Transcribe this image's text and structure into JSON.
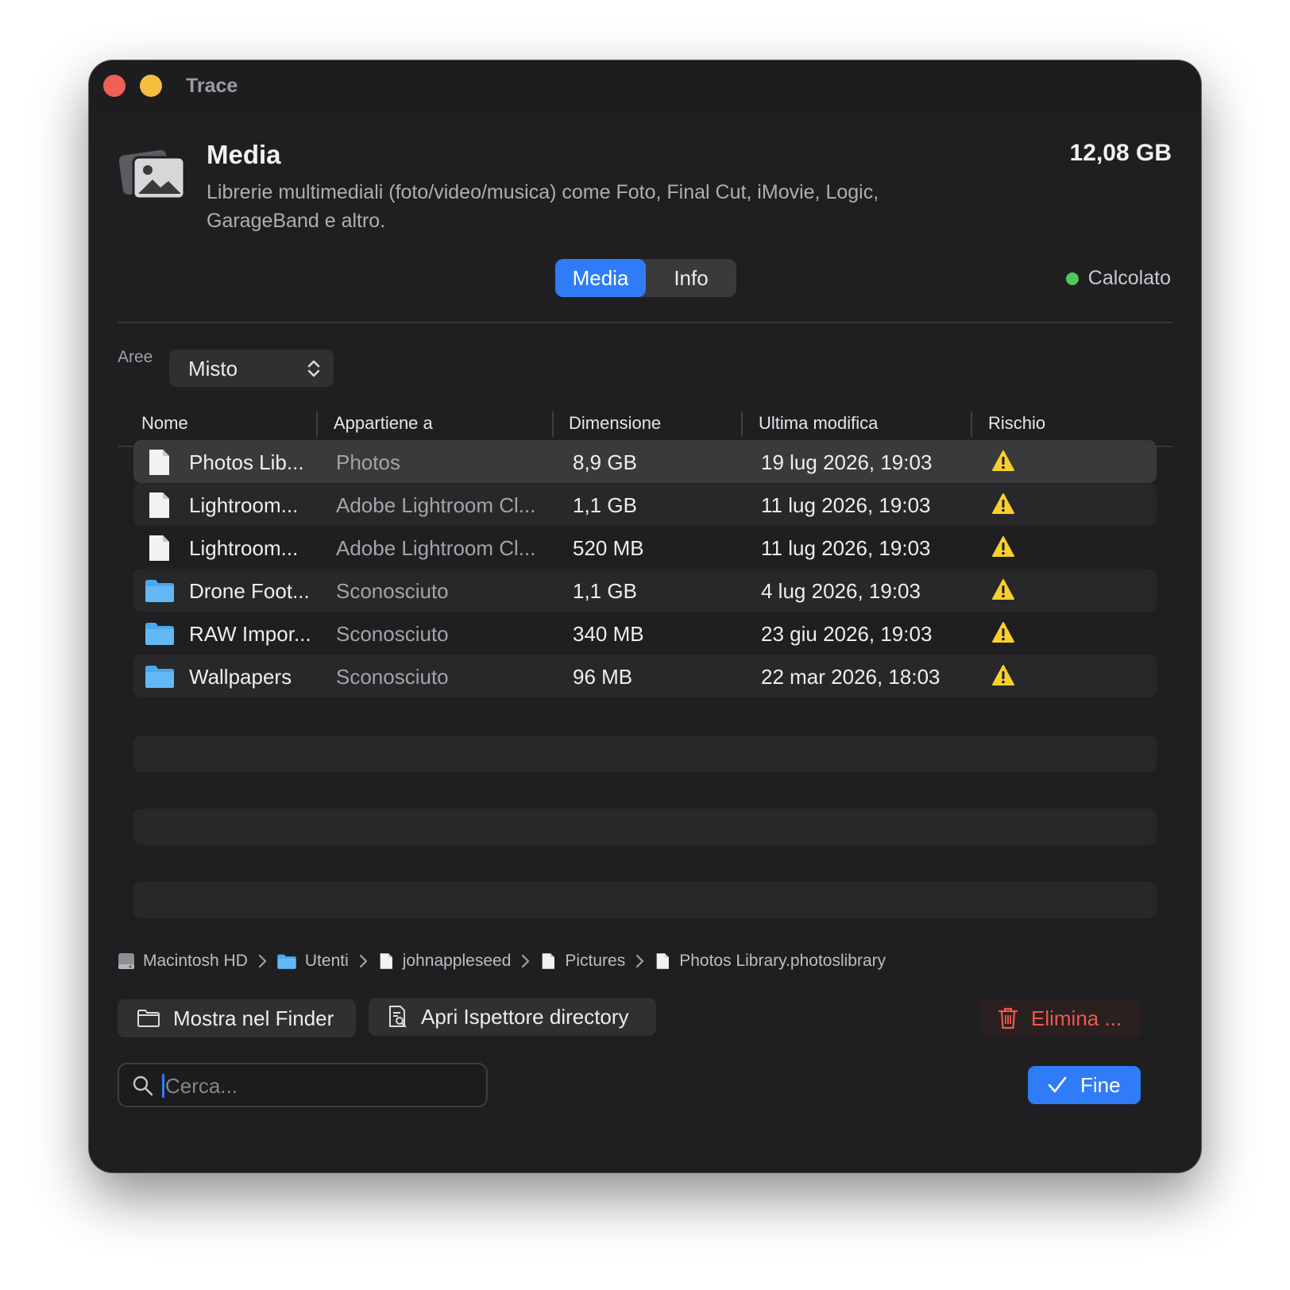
{
  "window": {
    "title": "Trace"
  },
  "header": {
    "title": "Media",
    "description": "Librerie multimediali (foto/video/musica) come Foto, Final Cut, iMovie, Logic, GarageBand e altro.",
    "total_size": "12,08 GB",
    "icon": "photo-library-icon"
  },
  "tabs": [
    {
      "label": "Media",
      "active": true
    },
    {
      "label": "Info",
      "active": false
    }
  ],
  "status": {
    "label": "Calcolato",
    "color": "#4fc85a"
  },
  "filter": {
    "label": "Aree",
    "value": "Misto"
  },
  "table": {
    "columns": [
      "Nome",
      "Appartiene a",
      "Dimensione",
      "Ultima modifica",
      "Rischio"
    ],
    "rows": [
      {
        "name": "Photos Lib...",
        "owner": "Photos",
        "size": "8,9 GB",
        "modified": "19 lug 2026, 19:03",
        "kind": "file",
        "risk": "warning"
      },
      {
        "name": "Lightroom...",
        "owner": "Adobe Lightroom Cl...",
        "size": "1,1 GB",
        "modified": "11 lug 2026, 19:03",
        "kind": "file",
        "risk": "warning"
      },
      {
        "name": "Lightroom...",
        "owner": "Adobe Lightroom Cl...",
        "size": "520 MB",
        "modified": "11 lug 2026, 19:03",
        "kind": "file",
        "risk": "warning"
      },
      {
        "name": "Drone Foot...",
        "owner": "Sconosciuto",
        "size": "1,1 GB",
        "modified": "4 lug 2026, 19:03",
        "kind": "folder",
        "risk": "warning"
      },
      {
        "name": "RAW Impor...",
        "owner": "Sconosciuto",
        "size": "340 MB",
        "modified": "23 giu 2026, 19:03",
        "kind": "folder",
        "risk": "warning"
      },
      {
        "name": "Wallpapers",
        "owner": "Sconosciuto",
        "size": "96 MB",
        "modified": "22 mar 2026, 18:03",
        "kind": "folder",
        "risk": "warning"
      }
    ]
  },
  "breadcrumb": [
    {
      "label": "Macintosh HD",
      "icon": "disk-icon"
    },
    {
      "label": "Utenti",
      "icon": "folder-icon"
    },
    {
      "label": "johnappleseed",
      "icon": "document-icon"
    },
    {
      "label": "Pictures",
      "icon": "document-icon"
    },
    {
      "label": "Photos Library.photoslibrary",
      "icon": "document-icon"
    }
  ],
  "actions": {
    "show_in_finder": "Mostra nel Finder",
    "open_inspector": "Apri Ispettore directory",
    "delete": "Elimina ...",
    "done": "Fine"
  },
  "search": {
    "placeholder": "Cerca..."
  },
  "colors": {
    "accent": "#2f7cf6",
    "danger": "#f0574c",
    "warning": "#f7cf2f"
  }
}
